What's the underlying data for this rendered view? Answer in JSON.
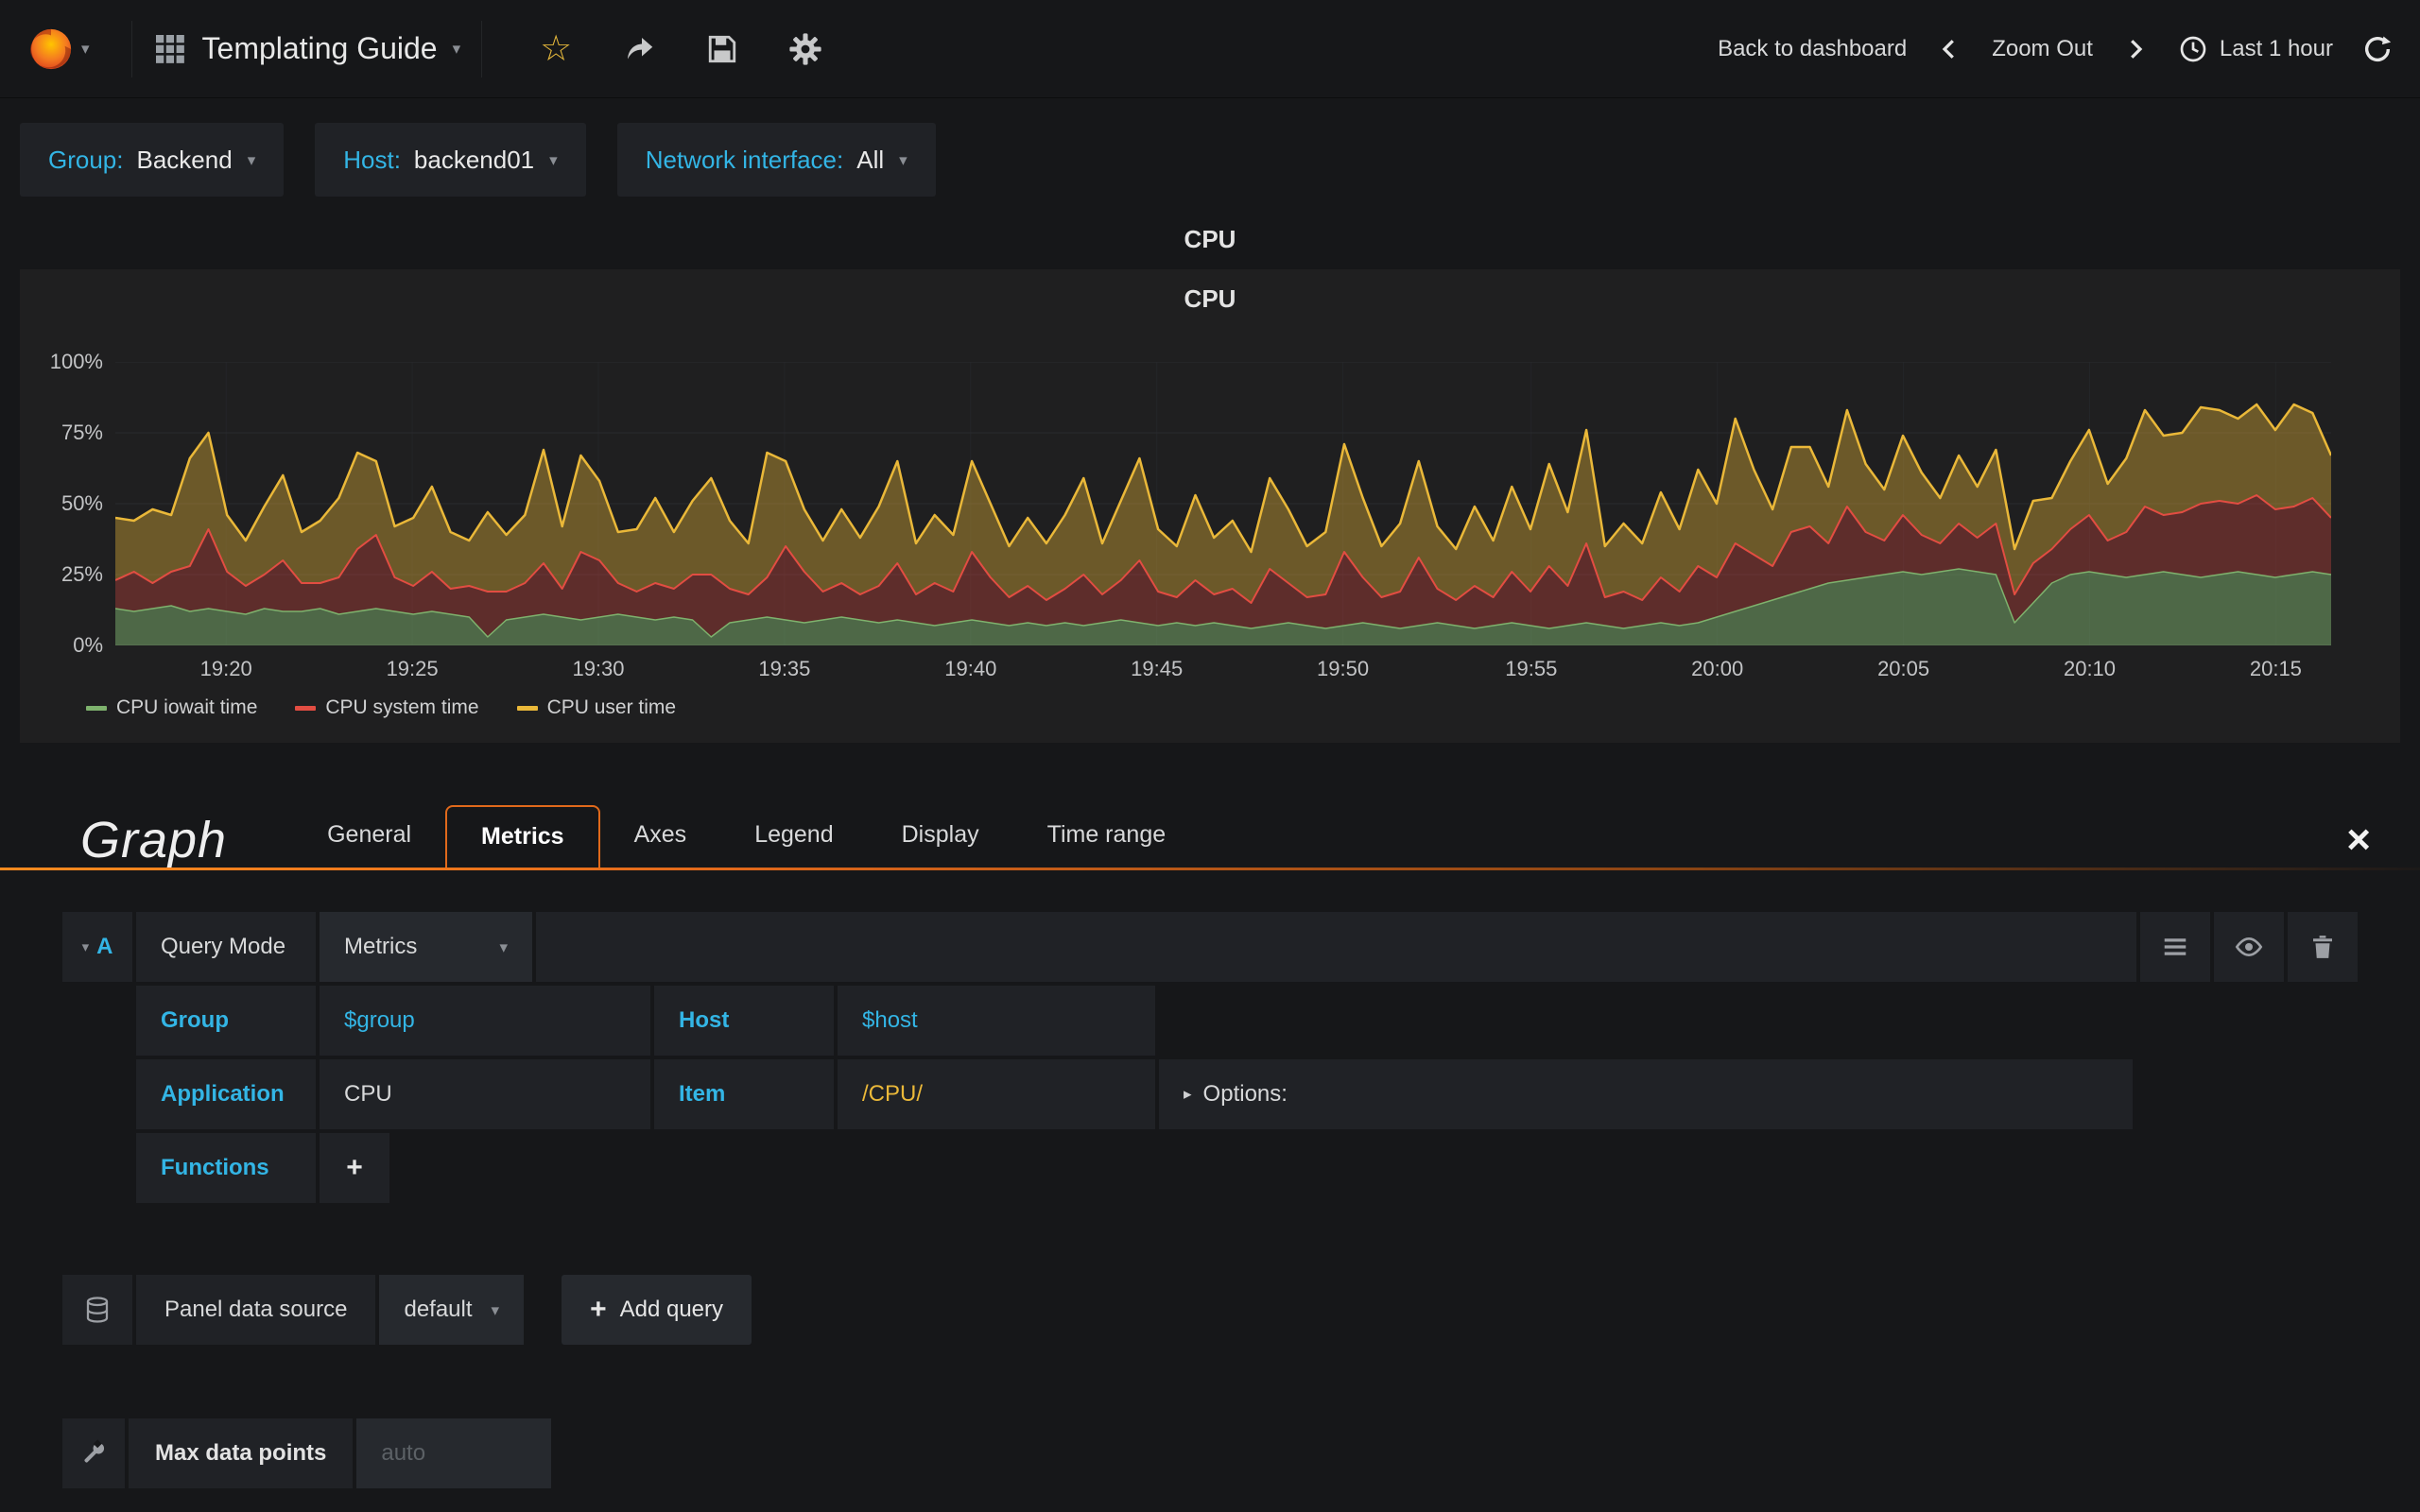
{
  "colors": {
    "accent_cyan": "#33b5e5",
    "accent_orange": "#e0691b",
    "page_bg": "#161719",
    "panel_bg": "#1f1f20",
    "cell_bg": "#202226"
  },
  "icons": {
    "star": "☆",
    "caret_down": "▾",
    "caret_right": "▸",
    "close": "×",
    "plus": "+"
  },
  "navbar": {
    "title": "Templating Guide",
    "back_to_dashboard": "Back to dashboard",
    "zoom_out": "Zoom Out",
    "time_label": "Last 1 hour"
  },
  "variables": [
    {
      "label": "Group:",
      "value": "Backend"
    },
    {
      "label": "Host:",
      "value": "backend01"
    },
    {
      "label": "Network interface:",
      "value": "All"
    }
  ],
  "panel": {
    "header_title": "CPU",
    "graph_title": "CPU"
  },
  "chart_data": {
    "type": "area",
    "stacked": true,
    "title": "CPU",
    "grid": true,
    "legend_position": "bottom",
    "ylim": [
      0,
      100
    ],
    "y_ticks": [
      "0%",
      "25%",
      "50%",
      "75%",
      "100%"
    ],
    "y_tick_values": [
      0,
      25,
      50,
      75,
      100
    ],
    "x_ticks": [
      "19:20",
      "19:25",
      "19:30",
      "19:35",
      "19:40",
      "19:45",
      "19:50",
      "19:55",
      "20:00",
      "20:05",
      "20:10",
      "20:15"
    ],
    "x_tick_fracs": [
      0.05,
      0.134,
      0.218,
      0.302,
      0.386,
      0.47,
      0.554,
      0.639,
      0.723,
      0.807,
      0.891,
      0.975
    ],
    "series": [
      {
        "name": "CPU iowait time",
        "color": "#7eb26d",
        "fill": "rgba(126,178,109,0.5)",
        "line_width": 1.5,
        "values": [
          13,
          12,
          13,
          14,
          12,
          13,
          12,
          11,
          13,
          12,
          12,
          13,
          11,
          12,
          13,
          12,
          11,
          12,
          11,
          10,
          3,
          9,
          10,
          11,
          10,
          9,
          10,
          11,
          10,
          9,
          10,
          9,
          3,
          8,
          9,
          10,
          9,
          8,
          9,
          10,
          9,
          8,
          9,
          8,
          7,
          8,
          9,
          8,
          7,
          8,
          7,
          8,
          7,
          8,
          9,
          8,
          7,
          8,
          7,
          8,
          7,
          6,
          7,
          8,
          7,
          6,
          7,
          8,
          7,
          6,
          7,
          8,
          7,
          6,
          7,
          8,
          7,
          6,
          7,
          8,
          7,
          6,
          7,
          8,
          7,
          8,
          10,
          12,
          14,
          16,
          18,
          20,
          22,
          23,
          24,
          25,
          26,
          25,
          26,
          27,
          26,
          25,
          8,
          15,
          22,
          25,
          26,
          25,
          24,
          25,
          26,
          25,
          24,
          25,
          26,
          25,
          24,
          25,
          26,
          25
        ]
      },
      {
        "name": "CPU system time",
        "color": "#e24d42",
        "fill": "rgba(226,77,66,0.33)",
        "line_width": 2,
        "values": [
          10,
          14,
          9,
          12,
          16,
          28,
          14,
          10,
          12,
          18,
          10,
          9,
          13,
          22,
          26,
          12,
          10,
          14,
          9,
          11,
          16,
          10,
          12,
          18,
          10,
          24,
          20,
          11,
          9,
          13,
          10,
          16,
          22,
          12,
          9,
          14,
          26,
          18,
          10,
          12,
          9,
          13,
          20,
          10,
          15,
          11,
          24,
          16,
          10,
          13,
          9,
          12,
          18,
          10,
          14,
          22,
          12,
          9,
          16,
          10,
          13,
          9,
          20,
          14,
          10,
          12,
          26,
          16,
          10,
          13,
          24,
          12,
          9,
          15,
          10,
          18,
          12,
          22,
          14,
          28,
          10,
          13,
          9,
          16,
          12,
          20,
          14,
          24,
          18,
          12,
          22,
          22,
          14,
          26,
          16,
          12,
          20,
          14,
          10,
          16,
          12,
          18,
          10,
          14,
          12,
          16,
          20,
          12,
          16,
          24,
          20,
          22,
          26,
          26,
          24,
          28,
          24,
          24,
          26,
          20
        ]
      },
      {
        "name": "CPU user time",
        "color": "#eab839",
        "fill": "rgba(234,184,57,0.38)",
        "line_width": 2.5,
        "values": [
          22,
          18,
          26,
          20,
          38,
          34,
          20,
          16,
          24,
          30,
          18,
          22,
          28,
          34,
          26,
          18,
          24,
          30,
          20,
          16,
          28,
          20,
          24,
          40,
          22,
          34,
          28,
          18,
          22,
          30,
          20,
          26,
          34,
          24,
          18,
          44,
          30,
          22,
          18,
          26,
          20,
          28,
          36,
          18,
          24,
          20,
          32,
          26,
          18,
          24,
          20,
          26,
          34,
          18,
          28,
          36,
          22,
          18,
          30,
          20,
          24,
          18,
          32,
          26,
          18,
          22,
          38,
          28,
          18,
          24,
          34,
          22,
          18,
          28,
          20,
          30,
          22,
          36,
          26,
          40,
          18,
          24,
          20,
          30,
          22,
          34,
          26,
          44,
          30,
          20,
          30,
          28,
          20,
          34,
          24,
          18,
          28,
          22,
          16,
          24,
          18,
          26,
          16,
          22,
          18,
          24,
          30,
          20,
          26,
          34,
          28,
          28,
          34,
          32,
          30,
          32,
          28,
          36,
          30,
          22
        ]
      }
    ]
  },
  "editor": {
    "panel_type": "Graph",
    "tabs": [
      {
        "label": "General",
        "active": false
      },
      {
        "label": "Metrics",
        "active": true
      },
      {
        "label": "Axes",
        "active": false
      },
      {
        "label": "Legend",
        "active": false
      },
      {
        "label": "Display",
        "active": false
      },
      {
        "label": "Time range",
        "active": false
      }
    ],
    "query": {
      "ref": "A",
      "query_mode_label": "Query Mode",
      "query_mode_value": "Metrics",
      "group_label": "Group",
      "group_value": "$group",
      "host_label": "Host",
      "host_value": "$host",
      "application_label": "Application",
      "application_value": "CPU",
      "item_label": "Item",
      "item_value": "/CPU/",
      "options_label": "Options:",
      "functions_label": "Functions",
      "add_function_label": "+"
    },
    "datasource": {
      "label": "Panel data source",
      "value": "default",
      "add_query_label": "Add query"
    },
    "max_data_points": {
      "label": "Max data points",
      "placeholder": "auto"
    }
  }
}
